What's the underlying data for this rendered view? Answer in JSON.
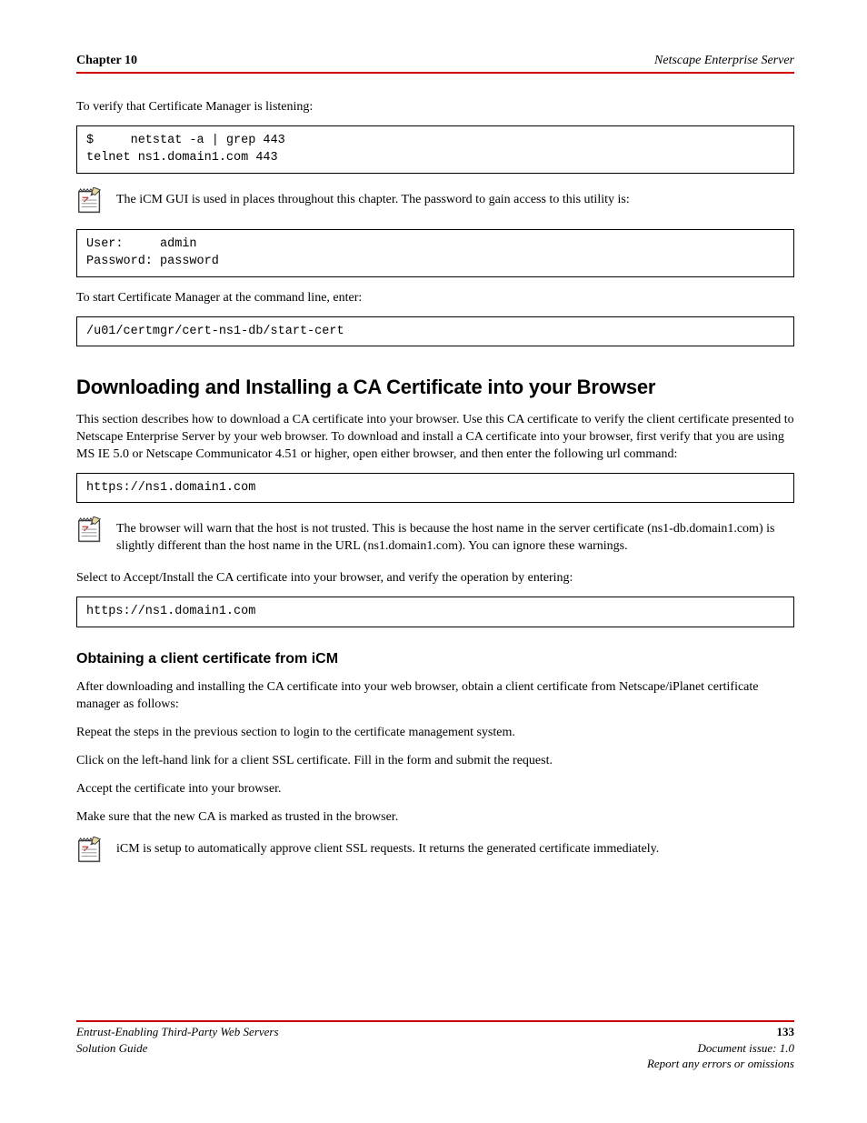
{
  "header": {
    "left": "Chapter 10",
    "right": "Netscape Enterprise Server"
  },
  "para1": "To verify that Certificate Manager is listening:",
  "code1": "$     netstat -a | grep 443\ntelnet ns1.domain1.com 443",
  "note1": "The iCM GUI is used in places throughout this chapter. The password to gain access to this utility is:",
  "code2": "User:     admin\nPassword: password",
  "para2": "To start Certificate Manager at the command line, enter:",
  "code3": "/u01/certmgr/cert-ns1-db/start-cert",
  "section1": {
    "title": "Downloading and Installing a CA Certificate into your Browser",
    "para": "This section describes how to download a CA certificate into your browser. Use this CA certificate to verify the client certificate presented to Netscape Enterprise Server by your web browser. To download and install a CA certificate into your browser, first verify that you are using MS IE 5.0 or Netscape Communicator 4.51 or higher, open either browser, and then enter the following url command:",
    "code": "https://ns1.domain1.com",
    "note": "The browser will warn that the host is not trusted. This is because the host name in the server certificate (ns1-db.domain1.com) is slightly different than the host name in the URL (ns1.domain1.com). You can ignore these warnings.",
    "para2": "Select to Accept/Install the CA certificate into your browser, and verify the operation by entering:",
    "code2": "https://ns1.domain1.com\n"
  },
  "section2": {
    "title": "Obtaining a client certificate from iCM",
    "paras": [
      "After downloading and installing the CA certificate into your web browser, obtain a client certificate from Netscape/iPlanet certificate manager as follows:",
      "Repeat the steps in the previous section to login to the certificate management system.",
      "Click on the left-hand link for a client SSL certificate. Fill in the form and submit the request.",
      "Accept the certificate into your browser.",
      "Make sure that the new CA is marked as trusted in the browser."
    ],
    "note": "iCM is setup to automatically approve client SSL requests. It returns the generated certificate immediately."
  },
  "footer": {
    "left_title": "Entrust-Enabling Third-Party Web Servers\nSolution Guide",
    "right_doc": "Document issue: 1.0",
    "right_date": "Report any errors or omissions",
    "page": "133"
  }
}
